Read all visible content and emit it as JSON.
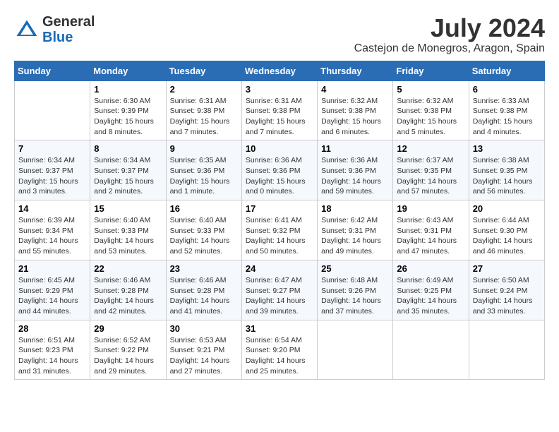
{
  "header": {
    "logo_general": "General",
    "logo_blue": "Blue",
    "month_title": "July 2024",
    "location": "Castejon de Monegros, Aragon, Spain"
  },
  "weekdays": [
    "Sunday",
    "Monday",
    "Tuesday",
    "Wednesday",
    "Thursday",
    "Friday",
    "Saturday"
  ],
  "weeks": [
    [
      {
        "day": "",
        "info": ""
      },
      {
        "day": "1",
        "info": "Sunrise: 6:30 AM\nSunset: 9:39 PM\nDaylight: 15 hours\nand 8 minutes."
      },
      {
        "day": "2",
        "info": "Sunrise: 6:31 AM\nSunset: 9:38 PM\nDaylight: 15 hours\nand 7 minutes."
      },
      {
        "day": "3",
        "info": "Sunrise: 6:31 AM\nSunset: 9:38 PM\nDaylight: 15 hours\nand 7 minutes."
      },
      {
        "day": "4",
        "info": "Sunrise: 6:32 AM\nSunset: 9:38 PM\nDaylight: 15 hours\nand 6 minutes."
      },
      {
        "day": "5",
        "info": "Sunrise: 6:32 AM\nSunset: 9:38 PM\nDaylight: 15 hours\nand 5 minutes."
      },
      {
        "day": "6",
        "info": "Sunrise: 6:33 AM\nSunset: 9:38 PM\nDaylight: 15 hours\nand 4 minutes."
      }
    ],
    [
      {
        "day": "7",
        "info": "Sunrise: 6:34 AM\nSunset: 9:37 PM\nDaylight: 15 hours\nand 3 minutes."
      },
      {
        "day": "8",
        "info": "Sunrise: 6:34 AM\nSunset: 9:37 PM\nDaylight: 15 hours\nand 2 minutes."
      },
      {
        "day": "9",
        "info": "Sunrise: 6:35 AM\nSunset: 9:36 PM\nDaylight: 15 hours\nand 1 minute."
      },
      {
        "day": "10",
        "info": "Sunrise: 6:36 AM\nSunset: 9:36 PM\nDaylight: 15 hours\nand 0 minutes."
      },
      {
        "day": "11",
        "info": "Sunrise: 6:36 AM\nSunset: 9:36 PM\nDaylight: 14 hours\nand 59 minutes."
      },
      {
        "day": "12",
        "info": "Sunrise: 6:37 AM\nSunset: 9:35 PM\nDaylight: 14 hours\nand 57 minutes."
      },
      {
        "day": "13",
        "info": "Sunrise: 6:38 AM\nSunset: 9:35 PM\nDaylight: 14 hours\nand 56 minutes."
      }
    ],
    [
      {
        "day": "14",
        "info": "Sunrise: 6:39 AM\nSunset: 9:34 PM\nDaylight: 14 hours\nand 55 minutes."
      },
      {
        "day": "15",
        "info": "Sunrise: 6:40 AM\nSunset: 9:33 PM\nDaylight: 14 hours\nand 53 minutes."
      },
      {
        "day": "16",
        "info": "Sunrise: 6:40 AM\nSunset: 9:33 PM\nDaylight: 14 hours\nand 52 minutes."
      },
      {
        "day": "17",
        "info": "Sunrise: 6:41 AM\nSunset: 9:32 PM\nDaylight: 14 hours\nand 50 minutes."
      },
      {
        "day": "18",
        "info": "Sunrise: 6:42 AM\nSunset: 9:31 PM\nDaylight: 14 hours\nand 49 minutes."
      },
      {
        "day": "19",
        "info": "Sunrise: 6:43 AM\nSunset: 9:31 PM\nDaylight: 14 hours\nand 47 minutes."
      },
      {
        "day": "20",
        "info": "Sunrise: 6:44 AM\nSunset: 9:30 PM\nDaylight: 14 hours\nand 46 minutes."
      }
    ],
    [
      {
        "day": "21",
        "info": "Sunrise: 6:45 AM\nSunset: 9:29 PM\nDaylight: 14 hours\nand 44 minutes."
      },
      {
        "day": "22",
        "info": "Sunrise: 6:46 AM\nSunset: 9:28 PM\nDaylight: 14 hours\nand 42 minutes."
      },
      {
        "day": "23",
        "info": "Sunrise: 6:46 AM\nSunset: 9:28 PM\nDaylight: 14 hours\nand 41 minutes."
      },
      {
        "day": "24",
        "info": "Sunrise: 6:47 AM\nSunset: 9:27 PM\nDaylight: 14 hours\nand 39 minutes."
      },
      {
        "day": "25",
        "info": "Sunrise: 6:48 AM\nSunset: 9:26 PM\nDaylight: 14 hours\nand 37 minutes."
      },
      {
        "day": "26",
        "info": "Sunrise: 6:49 AM\nSunset: 9:25 PM\nDaylight: 14 hours\nand 35 minutes."
      },
      {
        "day": "27",
        "info": "Sunrise: 6:50 AM\nSunset: 9:24 PM\nDaylight: 14 hours\nand 33 minutes."
      }
    ],
    [
      {
        "day": "28",
        "info": "Sunrise: 6:51 AM\nSunset: 9:23 PM\nDaylight: 14 hours\nand 31 minutes."
      },
      {
        "day": "29",
        "info": "Sunrise: 6:52 AM\nSunset: 9:22 PM\nDaylight: 14 hours\nand 29 minutes."
      },
      {
        "day": "30",
        "info": "Sunrise: 6:53 AM\nSunset: 9:21 PM\nDaylight: 14 hours\nand 27 minutes."
      },
      {
        "day": "31",
        "info": "Sunrise: 6:54 AM\nSunset: 9:20 PM\nDaylight: 14 hours\nand 25 minutes."
      },
      {
        "day": "",
        "info": ""
      },
      {
        "day": "",
        "info": ""
      },
      {
        "day": "",
        "info": ""
      }
    ]
  ]
}
